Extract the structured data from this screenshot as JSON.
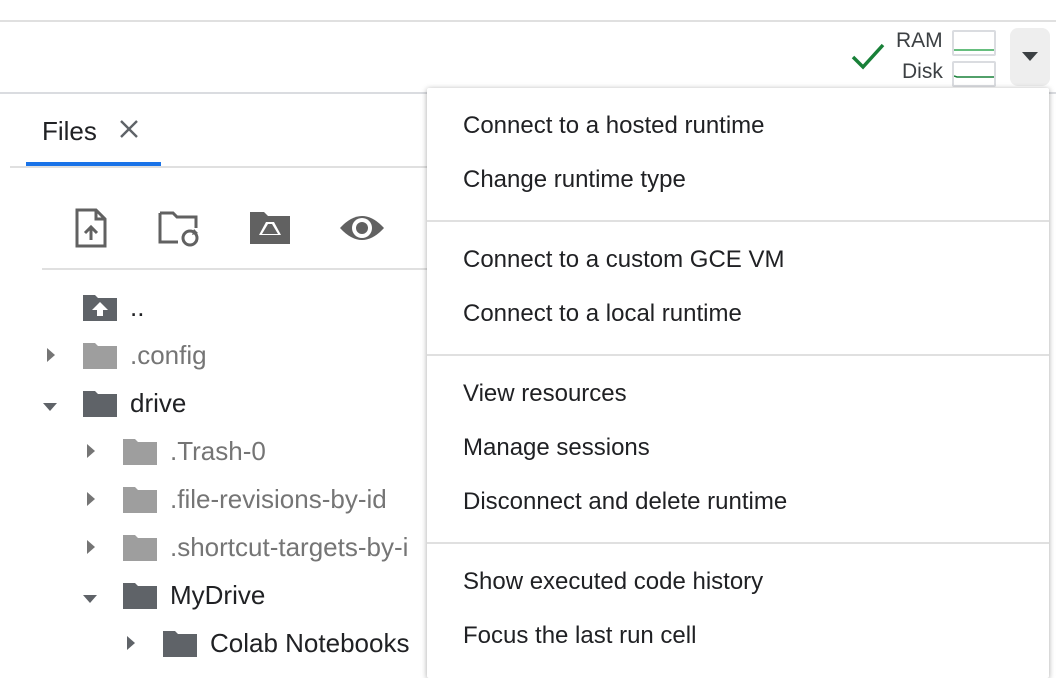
{
  "resources": {
    "ram_label": "RAM",
    "disk_label": "Disk",
    "status": "connected"
  },
  "files_tab": {
    "label": "Files"
  },
  "toolbar": {
    "icons": [
      "upload-file-icon",
      "refresh-icon",
      "mount-drive-icon",
      "toggle-hidden-files-icon"
    ]
  },
  "tree": [
    {
      "name": "..",
      "depth": 0
    },
    {
      "name": ".config",
      "depth": 0,
      "expanded": false
    },
    {
      "name": "drive",
      "depth": 0,
      "expanded": true
    },
    {
      "name": ".Trash-0",
      "depth": 1,
      "expanded": false
    },
    {
      "name": ".file-revisions-by-id",
      "depth": 1,
      "expanded": false
    },
    {
      "name": ".shortcut-targets-by-i",
      "depth": 1,
      "expanded": false
    },
    {
      "name": "MyDrive",
      "depth": 1,
      "expanded": true
    },
    {
      "name": "Colab Notebooks",
      "depth": 2,
      "expanded": false
    }
  ],
  "menu": {
    "group1": [
      "Connect to a hosted runtime",
      "Change runtime type"
    ],
    "group2": [
      "Connect to a custom GCE VM",
      "Connect to a local runtime"
    ],
    "group3": [
      "View resources",
      "Manage sessions",
      "Disconnect and delete runtime"
    ],
    "group4": [
      "Show executed code history",
      "Focus the last run cell"
    ]
  },
  "colors": {
    "accent": "#1a73e8",
    "check": "#188038",
    "folder_dark": "#5f6368",
    "folder_light": "#9e9e9e"
  }
}
